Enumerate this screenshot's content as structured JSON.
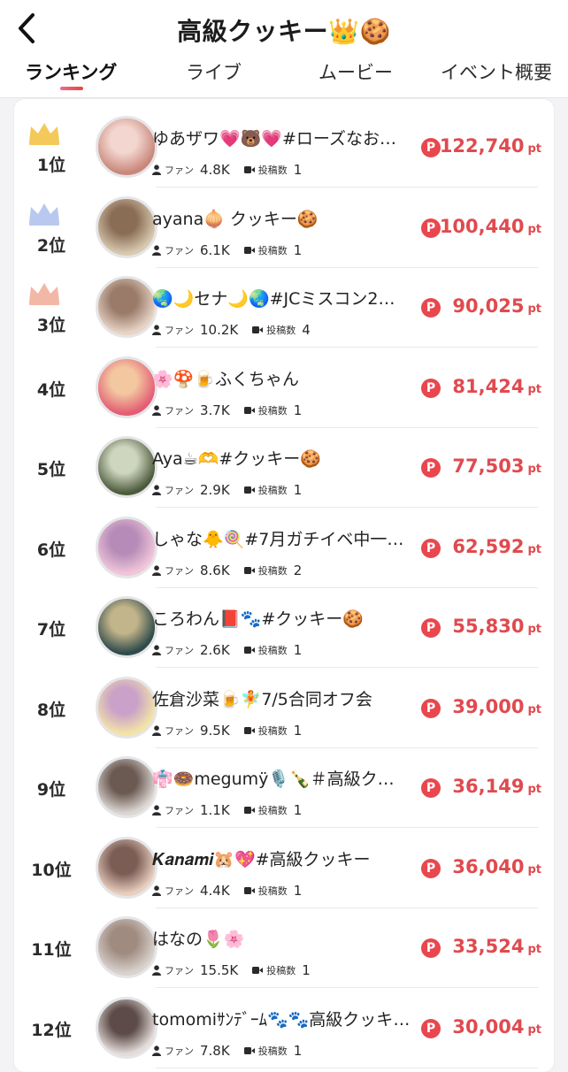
{
  "header": {
    "title": "高級クッキー👑🍪",
    "tabs": [
      "ランキング",
      "ライブ",
      "ムービー",
      "イベント概要"
    ]
  },
  "labels": {
    "fans": "ファン",
    "posts": "投稿数",
    "unit": "pt",
    "point_badge": "P"
  },
  "colors": {
    "accent": "#e04a4f",
    "crown_gold": "#f3c95a",
    "crown_silver": "#b9c8ee",
    "crown_bronze": "#f3b7a6"
  },
  "ranking": [
    {
      "rank": "1位",
      "name": "ゆあザワ💗🐻💗#ローズなお…",
      "fans": "4.8K",
      "posts": "1",
      "points": "122,740",
      "crown": "gold"
    },
    {
      "rank": "2位",
      "name": "ayana🧅 クッキー🍪",
      "fans": "6.1K",
      "posts": "1",
      "points": "100,440",
      "crown": "silver"
    },
    {
      "rank": "3位",
      "name": "🌏🌙セナ🌙🌏#JCミスコン2…",
      "fans": "10.2K",
      "posts": "4",
      "points": "90,025",
      "crown": "bronze"
    },
    {
      "rank": "4位",
      "name": "🌸🍄🍺ふくちゃん",
      "fans": "3.7K",
      "posts": "1",
      "points": "81,424"
    },
    {
      "rank": "5位",
      "name": "Aya☕🫶#クッキー🍪",
      "fans": "2.9K",
      "posts": "1",
      "points": "77,503"
    },
    {
      "rank": "6位",
      "name": "しゃな🐥🍭#7月ガチイベ中一…",
      "fans": "8.6K",
      "posts": "2",
      "points": "62,592"
    },
    {
      "rank": "7位",
      "name": "ころわん📕🐾#クッキー🍪",
      "fans": "2.6K",
      "posts": "1",
      "points": "55,830"
    },
    {
      "rank": "8位",
      "name": "佐倉沙菜🍺🧚7/5合同オフ会",
      "fans": "9.5K",
      "posts": "1",
      "points": "39,000"
    },
    {
      "rank": "9位",
      "name": "👘🍩megumÿ🎙️🍾＃高級ク…",
      "fans": "1.1K",
      "posts": "1",
      "points": "36,149"
    },
    {
      "rank": "10位",
      "name": "𝑲𝒂𝒏𝒂𝒎𝒊🐹💖#高級クッキー",
      "fans": "4.4K",
      "posts": "1",
      "points": "36,040"
    },
    {
      "rank": "11位",
      "name": "はなの🌷🌸",
      "fans": "15.5K",
      "posts": "1",
      "points": "33,524"
    },
    {
      "rank": "12位",
      "name": "tomomiｻﾝﾃﾞｰﾑ🐾🐾高級クッキー🍪",
      "fans": "7.8K",
      "posts": "1",
      "points": "30,004"
    }
  ]
}
